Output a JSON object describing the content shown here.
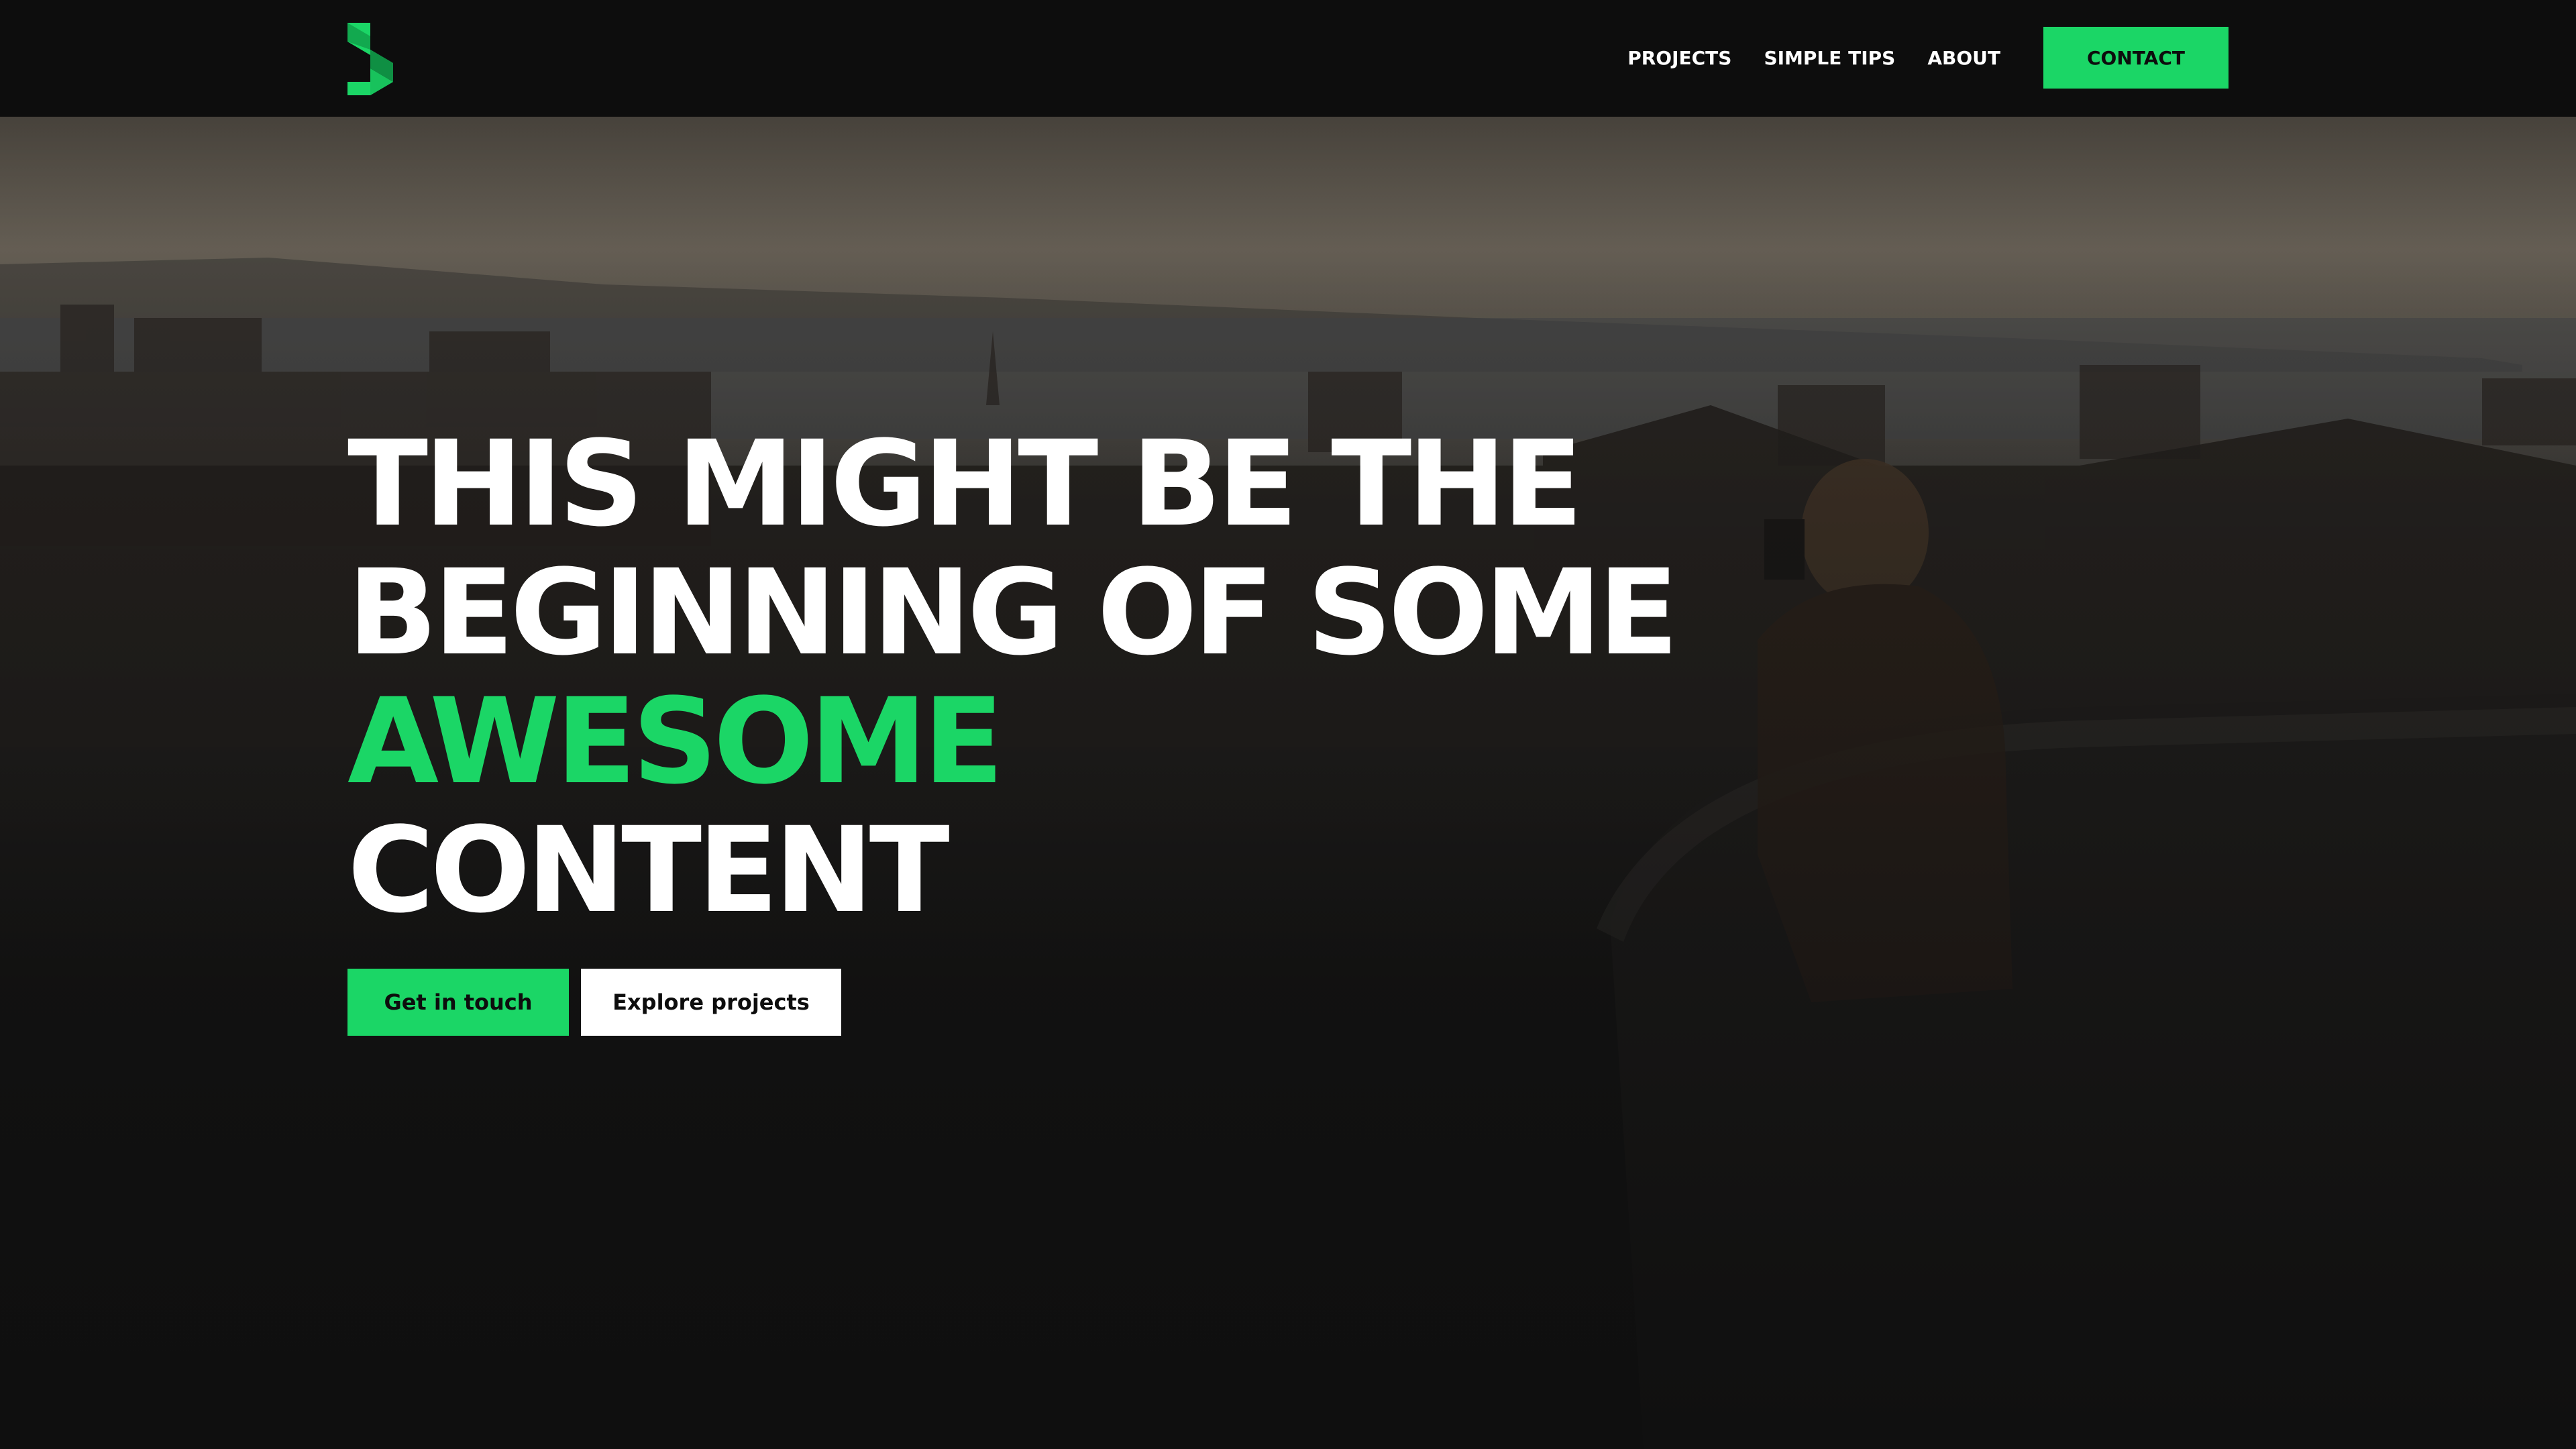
{
  "brand": {
    "logo_icon": "s-logo-icon",
    "accent_color": "#1bd666"
  },
  "nav": {
    "items": [
      {
        "label": "PROJECTS"
      },
      {
        "label": "SIMPLE TIPS"
      },
      {
        "label": "ABOUT"
      }
    ],
    "contact_label": "CONTACT"
  },
  "hero": {
    "headline": {
      "line1": "THIS MIGHT BE THE",
      "line2": "BEGINNING OF SOME",
      "line3_accent": "AWESOME",
      "line4": "CONTENT"
    },
    "primary_button": "Get in touch",
    "secondary_button": "Explore projects",
    "background": "city-skyline-photo"
  }
}
